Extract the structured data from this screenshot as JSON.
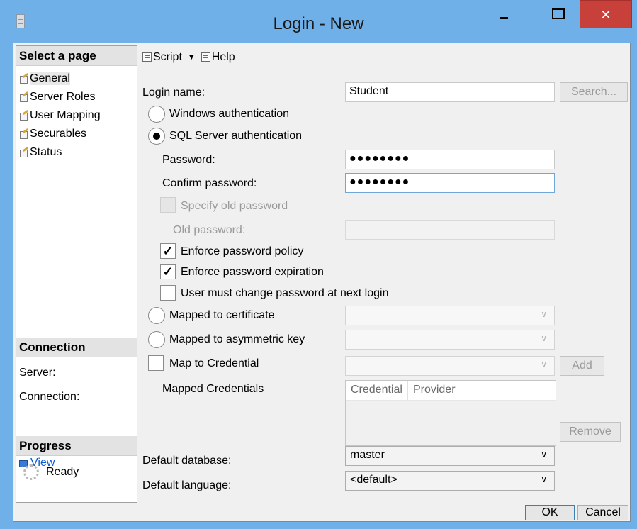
{
  "window": {
    "title": "Login - New",
    "close_glyph": "✕"
  },
  "left": {
    "select_header": "Select a page",
    "pages": [
      "General",
      "Server Roles",
      "User Mapping",
      "Securables",
      "Status"
    ],
    "connection_header": "Connection",
    "server_label": "Server:",
    "connection_label": "Connection:",
    "view_link": "View",
    "progress_header": "Progress",
    "progress_status": "Ready"
  },
  "toolbar": {
    "script_label": "Script",
    "help_label": "Help"
  },
  "form": {
    "login_name_label": "Login name:",
    "login_name_value": "Student",
    "search_button": "Search...",
    "windows_auth": "Windows authentication",
    "sql_auth": "SQL Server authentication",
    "sql_auth_selected": true,
    "password_label": "Password:",
    "password_value": "●●●●●●●●",
    "confirm_label": "Confirm password:",
    "confirm_value": "●●●●●●●●",
    "specify_old_label": "Specify old password",
    "old_password_label": "Old password:",
    "enforce_policy_label": "Enforce password policy",
    "enforce_policy_checked": true,
    "enforce_expiration_label": "Enforce password expiration",
    "enforce_expiration_checked": true,
    "must_change_label": "User must change password at next login",
    "must_change_checked": false,
    "mapped_cert_label": "Mapped to certificate",
    "mapped_asym_label": "Mapped to asymmetric key",
    "map_credential_label": "Map to Credential",
    "add_button": "Add",
    "mapped_credentials_label": "Mapped Credentials",
    "grid_columns": [
      "Credential",
      "Provider"
    ],
    "remove_button": "Remove",
    "default_db_label": "Default database:",
    "default_db_value": "master",
    "default_lang_label": "Default language:",
    "default_lang_value": "<default>"
  },
  "footer": {
    "ok_button": "OK",
    "cancel_button": "Cancel"
  },
  "colors": {
    "titlebar": "#6fb0e8",
    "close": "#c8403a",
    "link": "#0b5bd3"
  }
}
